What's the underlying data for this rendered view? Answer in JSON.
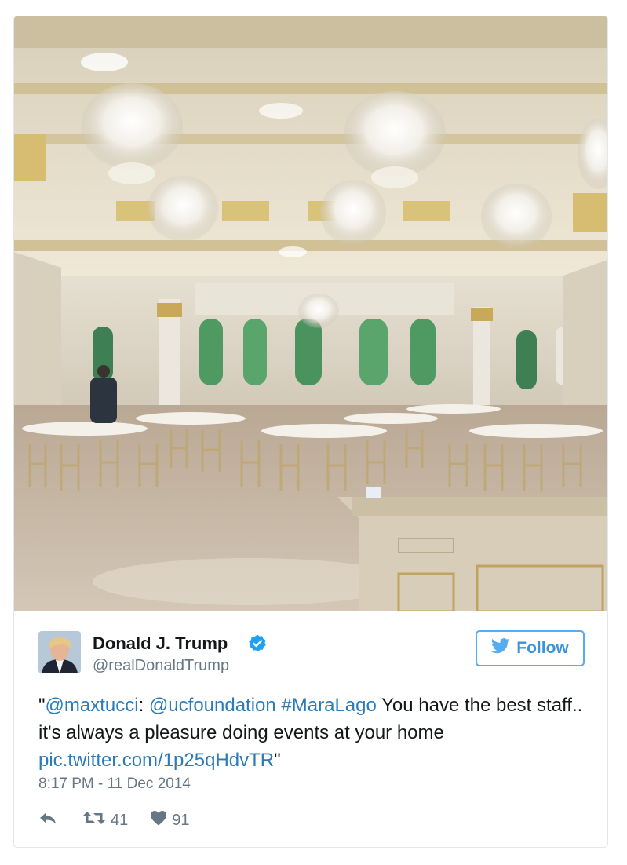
{
  "tweet": {
    "author": {
      "name": "Donald J. Trump",
      "handle": "@realDonaldTrump",
      "verified": true
    },
    "follow_label": "Follow",
    "text_parts": {
      "open_quote": "\"",
      "mention1": "@maxtucci",
      "colon": ": ",
      "mention2": "@ucfoundation",
      "space": " ",
      "hashtag": "#MaraLago",
      "body": " You have the best staff.. it's always a pleasure doing events at your home ",
      "pic_link": "pic.twitter.com/1p25qHdvTR",
      "close_quote": "\""
    },
    "timestamp": "8:17 PM - 11 Dec 2014",
    "retweet_count": "41",
    "like_count": "91"
  },
  "icons": {
    "verified": "verified-badge-icon",
    "follow": "twitter-bird-icon",
    "reply": "reply-icon",
    "retweet": "retweet-icon",
    "like": "heart-icon"
  },
  "colors": {
    "link": "#2b7bb9",
    "follow_border": "#55acee",
    "follow_text": "#3b94d9",
    "verified": "#1da1f2",
    "muted": "#657786",
    "text": "#14171a"
  }
}
